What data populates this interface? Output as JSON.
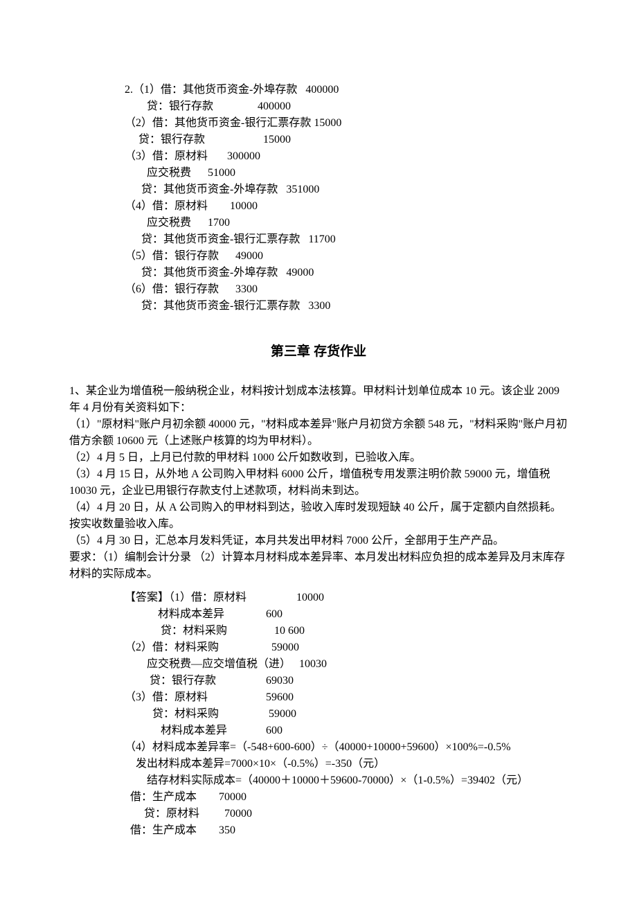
{
  "section1": {
    "lines": [
      "2.（1）借：其他货币资金-外埠存款   400000",
      "        贷：银行存款                400000",
      "（2）借：其他货币资金-银行汇票存款 15000",
      "     贷：银行存款                     15000",
      "（3）借：原材料       300000",
      "        应交税费      51000",
      "      贷：其他货币资金-外埠存款   351000",
      "（4）借：原材料        10000",
      "        应交税费      1700",
      "      贷：其他货币资金-银行汇票存款   11700",
      "（5）借：银行存款      49000",
      "      贷：其他货币资金-外埠存款   49000",
      "（6）借：银行存款      3300",
      "      贷：其他货币资金-银行汇票存款   3300"
    ]
  },
  "chapter_title": "第三章 存货作业",
  "question": {
    "paras": [
      "1、某企业为增值税一般纳税企业，材料按计划成本法核算。甲材料计划单位成本 10 元。该企业 2009 年 4 月份有关资料如下：",
      "（1）\"原材料\"账户月初余额 40000 元，\"材料成本差异\"账户月初贷方余额 548 元，\"材料采购\"账户月初借方余额 10600 元（上述账户核算的均为甲材料）。",
      "（2）4 月 5 日，上月已付款的甲材料 1000 公斤如数收到，已验收入库。",
      "（3）4 月 15 日，从外地 A 公司购入甲材料 6000 公斤，增值税专用发票注明价款 59000 元，增值税 10030 元，企业已用银行存款支付上述款项，材料尚未到达。",
      "（4）4 月 20 日，从 A 公司购入的甲材料到达，验收入库时发现短缺 40 公斤，属于定额内自然损耗。按实收数量验收入库。",
      "（5）4 月 30 日，汇总本月发料凭证，本月共发出甲材料 7000 公斤，全部用于生产产品。",
      "要求：（1）编制会计分录    （2）计算本月材料成本差异率、本月发出材料应负担的成本差异及月末库存材料的实际成本。"
    ]
  },
  "answer": {
    "lines": [
      "【答案】（1）借：原材料                  10000",
      "            材料成本差异               600",
      "             贷：材料采购                 10 600",
      "（2）借：材料采购                   59000",
      "        应交税费—应交增值税（进）   10030",
      "         贷：银行存款                  69030",
      "（3）借：原材料                     59600",
      "          贷：材料采购                  59000",
      "             材料成本差异              600",
      "（4）材料成本差异率=（-548+600-600）÷（40000+10000+59600）×100%=-0.5%",
      "    发出材料成本差异=7000×10×（-0.5%）=-350（元）",
      "        结存材料实际成本=（40000＋10000＋59600-70000）×（1-0.5%）=39402（元）",
      "  借：生产成本        70000",
      "       贷：原材料         70000",
      "  借：生产成本        350"
    ]
  }
}
